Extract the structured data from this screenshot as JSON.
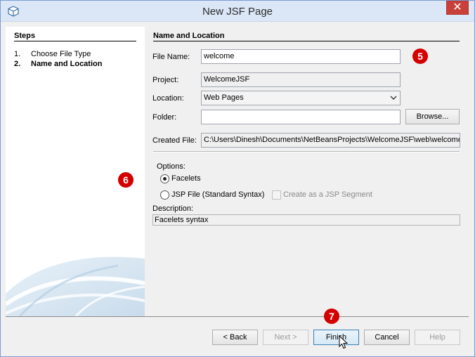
{
  "window": {
    "title": "New JSF Page",
    "close_symbol": "✕"
  },
  "steps": {
    "title": "Steps",
    "items": [
      {
        "number": "1.",
        "label": "Choose File Type"
      },
      {
        "number": "2.",
        "label": "Name and Location"
      }
    ]
  },
  "section": {
    "title": "Name and Location"
  },
  "form": {
    "file_name_label": "File Name:",
    "file_name_value": "welcome",
    "project_label": "Project:",
    "project_value": "WelcomeJSF",
    "location_label": "Location:",
    "location_value": "Web Pages",
    "folder_label": "Folder:",
    "folder_value": "",
    "browse_label": "Browse...",
    "created_file_label": "Created File:",
    "created_file_value": "C:\\Users\\Dinesh\\Documents\\NetBeansProjects\\WelcomeJSF\\web\\welcome.x"
  },
  "options": {
    "label": "Options:",
    "facelets_label": "Facelets",
    "facelets_selected": true,
    "jsp_label": "JSP File (Standard Syntax)",
    "jsp_selected": false,
    "segment_label": "Create as a JSP Segment",
    "segment_enabled": false
  },
  "description": {
    "label": "Description:",
    "value": "Facelets syntax"
  },
  "buttons": {
    "back": "< Back",
    "next": "Next >",
    "finish": "Finish",
    "cancel": "Cancel",
    "help": "Help"
  },
  "annotations": {
    "badge_5": "5",
    "badge_6": "6",
    "badge_7": "7"
  },
  "colors": {
    "badge": "#d40000",
    "titlebar": "#dbe7f7",
    "close_button": "#c7403a"
  },
  "icons": [
    "netbeans-cube-icon",
    "close-icon",
    "dropdown-arrow-icon",
    "mouse-pointer-icon"
  ]
}
